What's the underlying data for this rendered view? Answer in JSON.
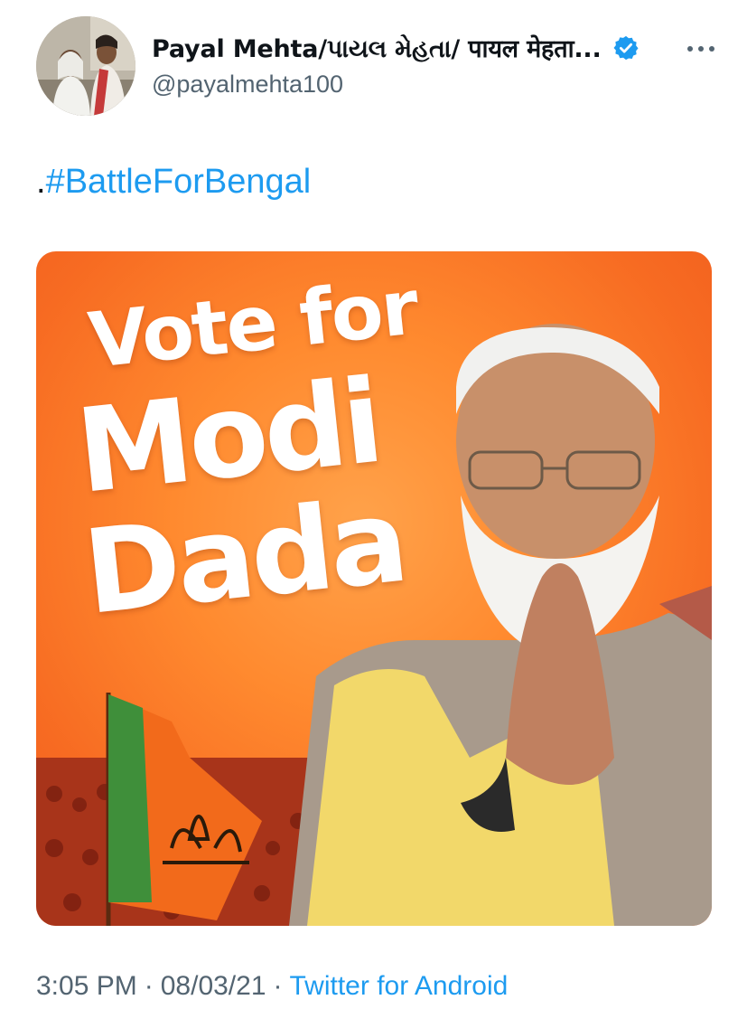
{
  "author": {
    "display_name": "Payal Mehta/પાયલ મેહતા/ पायल मेहता...",
    "handle": "@payalmehta100",
    "verified_badge_icon": "verified-check-icon",
    "more_icon": "more-dots-icon"
  },
  "tweet": {
    "prefix": ".",
    "hashtag": "#BattleForBengal"
  },
  "media": {
    "poster_lines": [
      "Vote for",
      "Modi",
      "Dada"
    ],
    "colors": {
      "background": "#f76b22",
      "text": "#ffffff"
    }
  },
  "footer": {
    "time": "3:05 PM",
    "date": "08/03/21",
    "separator": "·",
    "source": "Twitter for Android"
  },
  "colors": {
    "link": "#1d9bf0",
    "secondary_text": "#536471",
    "primary_text": "#0f1419"
  }
}
